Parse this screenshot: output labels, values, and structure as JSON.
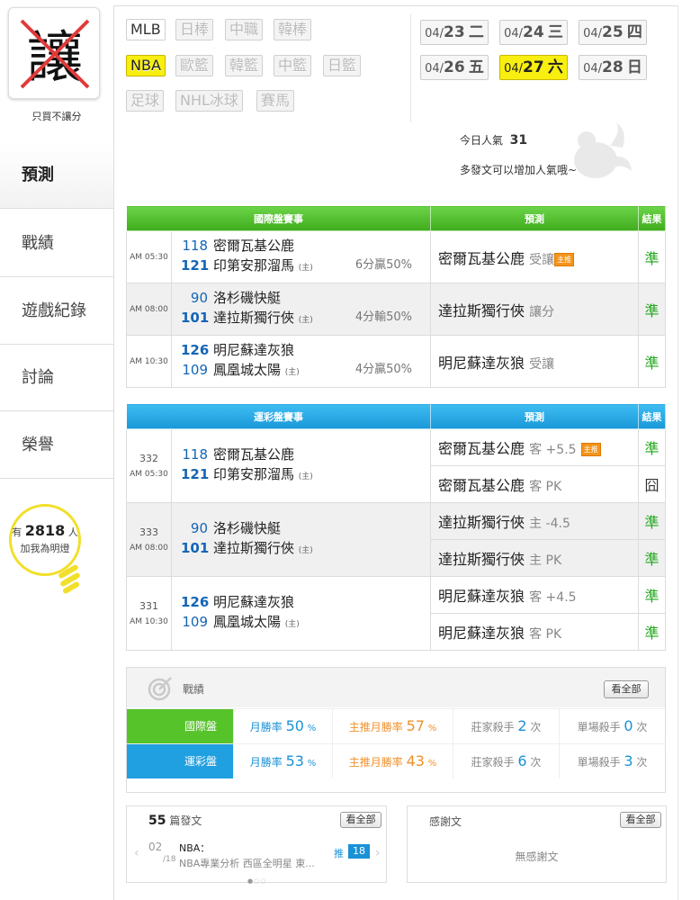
{
  "sidebar": {
    "avatar_char": "讓",
    "name": "只買不讓分",
    "menu": [
      "預測",
      "戰績",
      "遊戲紀錄",
      "討論",
      "榮譽"
    ],
    "fans_prefix": "有",
    "fans_count": "2818",
    "fans_suffix": "人",
    "fans_action": "加我為明燈"
  },
  "leagues": [
    {
      "label": "MLB",
      "state": "on"
    },
    {
      "label": "日棒",
      "state": "off"
    },
    {
      "label": "中職",
      "state": "off"
    },
    {
      "label": "韓棒",
      "state": "off"
    },
    {
      "label": "NBA",
      "state": "selected"
    },
    {
      "label": "歐籃",
      "state": "off"
    },
    {
      "label": "韓籃",
      "state": "off"
    },
    {
      "label": "中籃",
      "state": "off"
    },
    {
      "label": "日籃",
      "state": "off"
    },
    {
      "label": "足球",
      "state": "off"
    },
    {
      "label": "NHL冰球",
      "state": "off"
    },
    {
      "label": "賽馬",
      "state": "off"
    }
  ],
  "dates": [
    {
      "md": "04/",
      "d": "23",
      "w": "二"
    },
    {
      "md": "04/",
      "d": "24",
      "w": "三"
    },
    {
      "md": "04/",
      "d": "25",
      "w": "四"
    },
    {
      "md": "04/",
      "d": "26",
      "w": "五"
    },
    {
      "md": "04/",
      "d": "27",
      "w": "六",
      "selected": true
    },
    {
      "md": "04/",
      "d": "28",
      "w": "日"
    }
  ],
  "popularity": {
    "label": "今日人氣",
    "value": "31",
    "hint": "多發文可以增加人氣哦~"
  },
  "intl_table": {
    "headers": [
      "國際盤賽事",
      "預測",
      "結果"
    ],
    "rows": [
      {
        "time": "AM 05:30",
        "s1": "118",
        "t1": "密爾瓦基公鹿",
        "s2": "121",
        "t2": "印第安那溜馬",
        "home": "(主)",
        "line": "6分贏50%",
        "pick": "密爾瓦基公鹿",
        "pick_side": "受讓",
        "badge": "主推",
        "result": "準"
      },
      {
        "time": "AM 08:00",
        "s1": "90",
        "t1": "洛杉磯快艇",
        "s2": "101",
        "t2": "達拉斯獨行俠",
        "home": "(主)",
        "line": "4分輸50%",
        "pick": "達拉斯獨行俠",
        "pick_side": "讓分",
        "badge": "",
        "result": "準"
      },
      {
        "time": "AM 10:30",
        "s1": "126",
        "t1": "明尼蘇達灰狼",
        "s2": "109",
        "t2": "鳳凰城太陽",
        "home": "(主)",
        "line": "4分贏50%",
        "pick": "明尼蘇達灰狼",
        "pick_side": "受讓",
        "badge": "",
        "result": "準"
      }
    ]
  },
  "sport_table": {
    "headers": [
      "運彩盤賽事",
      "預測",
      "結果"
    ],
    "rows": [
      {
        "no": "332",
        "time": "AM 05:30",
        "s1": "118",
        "t1": "密爾瓦基公鹿",
        "s2": "121",
        "t2": "印第安那溜馬",
        "home": "(主)",
        "picks": [
          {
            "team": "密爾瓦基公鹿",
            "side": "客 +5.5",
            "badge": "主推",
            "result": "準"
          },
          {
            "team": "密爾瓦基公鹿",
            "side": "客 PK",
            "badge": "",
            "result": "囧"
          }
        ]
      },
      {
        "no": "333",
        "time": "AM 08:00",
        "s1": "90",
        "t1": "洛杉磯快艇",
        "s2": "101",
        "t2": "達拉斯獨行俠",
        "home": "(主)",
        "picks": [
          {
            "team": "達拉斯獨行俠",
            "side": "主 -4.5",
            "badge": "",
            "result": "準"
          },
          {
            "team": "達拉斯獨行俠",
            "side": "主 PK",
            "badge": "",
            "result": "準"
          }
        ]
      },
      {
        "no": "331",
        "time": "AM 10:30",
        "s1": "126",
        "t1": "明尼蘇達灰狼",
        "s2": "109",
        "t2": "鳳凰城太陽",
        "home": "(主)",
        "picks": [
          {
            "team": "明尼蘇達灰狼",
            "side": "客 +4.5",
            "badge": "",
            "result": "準"
          },
          {
            "team": "明尼蘇達灰狼",
            "side": "客 PK",
            "badge": "",
            "result": "準"
          }
        ]
      }
    ]
  },
  "record": {
    "title": "戰績",
    "view_all": "看全部",
    "rows": [
      {
        "label": "國際盤",
        "m_lab": "月勝率",
        "m_val": "50",
        "pct": "%",
        "k_lab": "主推月勝率",
        "k_val": "57",
        "z_lab": "莊家殺手",
        "z_val": "2",
        "unit": "次",
        "s_lab": "單場殺手",
        "s_val": "0"
      },
      {
        "label": "運彩盤",
        "m_lab": "月勝率",
        "m_val": "53",
        "pct": "%",
        "k_lab": "主推月勝率",
        "k_val": "43",
        "z_lab": "莊家殺手",
        "z_val": "6",
        "unit": "次",
        "s_lab": "單場殺手",
        "s_val": "3"
      }
    ]
  },
  "posts": {
    "count": "55",
    "label": "篇發文",
    "view_all": "看全部",
    "date_md": "02",
    "date_d": "18",
    "title": "NBA：",
    "subtitle": "NBA專業分析 西區全明星 東...",
    "push_label": "推",
    "push_count": "18"
  },
  "thanks": {
    "title": "感謝文",
    "view_all": "看全部",
    "empty": "無感謝文"
  }
}
